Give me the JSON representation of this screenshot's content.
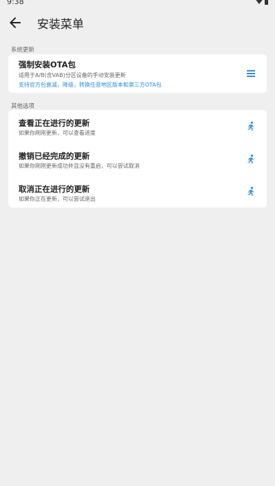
{
  "status_bar": {
    "time": "9:38"
  },
  "app_bar": {
    "title": "安装菜单",
    "back_icon": "arrow-left-icon"
  },
  "colors": {
    "accent": "#2b8ce0",
    "background": "#efefef",
    "card": "#ffffff"
  },
  "sections": {
    "system_update": {
      "label": "系统更新",
      "items": [
        {
          "title": "强制安装OTA包",
          "subtitle": "适用于A/B(含VAB)分区设备的手动安装更新",
          "link": "支持官方包衰减，降级，转换任意地区版本和第三方OTA包",
          "icon": "menu-icon"
        }
      ]
    },
    "other_options": {
      "label": "其他选项",
      "items": [
        {
          "title": "查看正在进行的更新",
          "subtitle": "如果你刚刚更新，可以查看进度",
          "icon": "run-icon"
        },
        {
          "title": "撤销已经完成的更新",
          "subtitle": "如果你刚刚更新成功并且没有重启，可以尝试取消",
          "icon": "run-icon"
        },
        {
          "title": "取消正在进行的更新",
          "subtitle": "如果你正在更新，可以尝试退出",
          "icon": "run-icon"
        }
      ]
    }
  }
}
